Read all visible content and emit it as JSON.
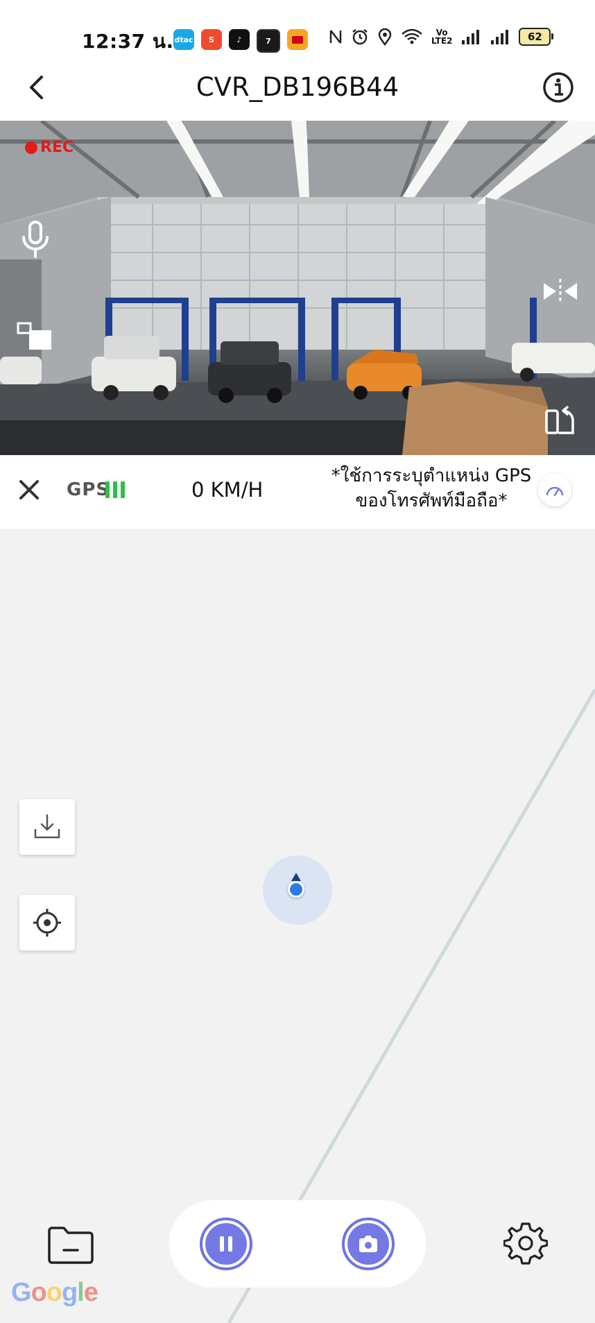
{
  "status_bar": {
    "time": "12:37 น.",
    "apps": [
      {
        "name": "dtac-app-icon",
        "label": "dtac",
        "color": "#19a9e5"
      },
      {
        "name": "shopee-app-icon",
        "label": "S",
        "color": "#ee4d2d"
      },
      {
        "name": "tiktok-app-icon",
        "label": "♪",
        "color": "#111111"
      },
      {
        "name": "seven-eleven-app-icon",
        "label": "7",
        "color": "#1a1a1a"
      },
      {
        "name": "lineman-app-icon",
        "label": "",
        "color": "#f5a623"
      }
    ],
    "volte": "Vo\nLTE2",
    "battery": "62"
  },
  "header": {
    "title": "CVR_DB196B44"
  },
  "camera": {
    "rec_label": "REC"
  },
  "gps": {
    "label": "GPS",
    "signal_bars": 3,
    "speed": "0 KM/H",
    "note": "*ใช้การระบุตำแหน่ง GPS ของโทรศัพท์มือถือ*"
  },
  "map": {
    "attribution": "Google"
  },
  "colors": {
    "accent": "#7479e6",
    "gps_ok": "#2fbf4a",
    "rec": "#e41a1a",
    "location": "#2e7be4"
  }
}
